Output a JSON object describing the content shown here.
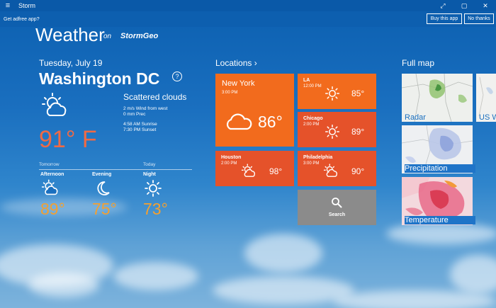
{
  "app": {
    "title": "Storm",
    "min_glyph": "⤢",
    "restore_glyph": "▢",
    "close_glyph": "✕",
    "menu_glyph": "≡"
  },
  "adbar": {
    "text": "Get adfree app?",
    "buy": "Buy this app",
    "no": "No thanks"
  },
  "header": {
    "title": "Weather",
    "on": "on",
    "brand": "StormGeo"
  },
  "current": {
    "date": "Tuesday, July 19",
    "city": "Washington DC",
    "help": "?",
    "condition": "Scattered clouds",
    "wind": "2 m/s Wind from west",
    "prec": "0 mm Prec",
    "sunrise": "4:58 AM Sunrise",
    "sunset": "7:30 PM Sunset",
    "temp": "91° F",
    "icon": "sun-cloud-icon"
  },
  "forecast": {
    "tomorrow_label": "Tomorrow",
    "today_label": "Today",
    "periods": [
      {
        "label": "Afternoon",
        "temp": "89°",
        "icon": "sun-cloud-icon"
      },
      {
        "label": "Evening",
        "temp": "75°",
        "icon": "moon-icon"
      },
      {
        "label": "Night",
        "temp": "73°",
        "icon": "sun-icon"
      }
    ]
  },
  "locations": {
    "heading": "Locations ›",
    "tiles": [
      {
        "city": "New York",
        "time": "3:00 PM",
        "temp": "86°",
        "icon": "cloud-icon",
        "color": "#f26b1d"
      },
      {
        "city": "LA",
        "time": "12:00 PM",
        "temp": "85°",
        "icon": "sun-icon",
        "color": "#f26b1d"
      },
      {
        "city": "Chicago",
        "time": "2:00 PM",
        "temp": "89°",
        "icon": "sun-icon",
        "color": "#e5522a"
      },
      {
        "city": "Houston",
        "time": "2:00 PM",
        "temp": "98°",
        "icon": "sun-cloud-icon",
        "color": "#e5522a"
      },
      {
        "city": "Philadelphia",
        "time": "3:00 PM",
        "temp": "90°",
        "icon": "sun-cloud-icon",
        "color": "#e5522a"
      }
    ],
    "search": {
      "label": "Search",
      "color": "#8b8b8b",
      "icon": "search-icon"
    }
  },
  "fullmap": {
    "heading": "Full map",
    "tiles": [
      {
        "label": "Radar"
      },
      {
        "label": "US W"
      },
      {
        "label": "Precipitation"
      },
      {
        "label": "Temperature"
      }
    ]
  }
}
